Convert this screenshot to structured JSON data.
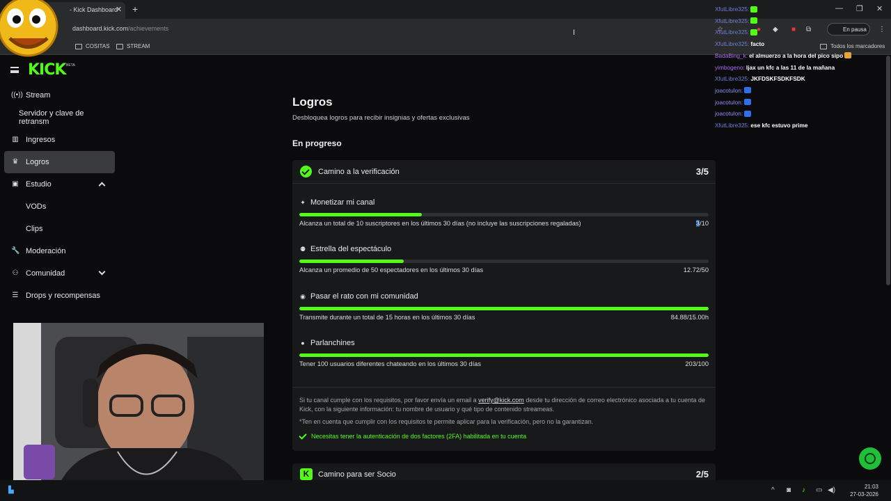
{
  "browser": {
    "tab_title": "- Kick Dashboard",
    "url_host": "dashboard.kick.com",
    "url_path": "/achievements",
    "bookmarks": [
      "COSITAS",
      "STREAM"
    ],
    "bookmarks_all": "Todos los marcadores",
    "pause_label": "En pausa"
  },
  "sidebar": {
    "logo": "KICK",
    "logo_badge": "BETA",
    "items": [
      {
        "label": "Stream"
      },
      {
        "label": "Servidor y clave de retransm"
      },
      {
        "label": "Ingresos"
      },
      {
        "label": "Logros"
      },
      {
        "label": "Estudio"
      },
      {
        "label": "VODs"
      },
      {
        "label": "Clips"
      },
      {
        "label": "Moderación"
      },
      {
        "label": "Comunidad"
      },
      {
        "label": "Drops y recompensas"
      }
    ]
  },
  "main": {
    "title": "Logros",
    "subtitle": "Desbloquea logros para recibir insignias y ofertas exclusivas",
    "section": "En progreso",
    "card1": {
      "title": "Camino a la verificación",
      "count": "3/5",
      "achievements": [
        {
          "icon": "sparkle-icon",
          "title": "Monetizar mi canal",
          "desc": "Alcanza un total de 10 suscriptores en los últimos 30 días (no incluye las suscripciones regaladas)",
          "value_a": "3",
          "value_b": "/10",
          "progress": 0.3
        },
        {
          "icon": "users-icon",
          "title": "Estrella del espectáculo",
          "desc": "Alcanza un promedio de 50 espectadores en los últimos 30 días",
          "value": "12.72/50",
          "progress": 0.2544
        },
        {
          "icon": "broadcast-icon",
          "title": "Pasar el rato con mi comunidad",
          "desc": "Transmite durante un total de 15 horas en los últimos 30 días",
          "value": "84.88/15.00h",
          "progress": 1
        },
        {
          "icon": "chat-icon",
          "title": "Parlanchines",
          "desc": "Tener 100 usuarios diferentes chateando en los últimos 30 días",
          "value": "203/100",
          "progress": 1
        }
      ],
      "footer_pre": "Si tu canal cumple con los requisitos, por favor envía un email a",
      "footer_link": "verify@kick.com",
      "footer_post": "desde tu dirección de correo electrónico asociada a tu cuenta de Kick, con la siguiente información: tu nombre de usuario y qué tipo de contenido streameas.",
      "footer_note": "*Ten en cuenta que cumplir con los requisitos te permite aplicar para la verificación, pero no la garantizan.",
      "footer_2fa": "Necesitas tener la autenticación de dos factores (2FA) habilitada en tu cuenta"
    },
    "card2": {
      "title": "Camino para ser Socio",
      "count": "2/5",
      "badge": "K"
    }
  },
  "chat": [
    {
      "user": "XfutLibre325:",
      "msg": "",
      "emote": "#53fc18",
      "style": ""
    },
    {
      "user": "XfutLibre325:",
      "msg": "",
      "emote": "#53fc18",
      "style": ""
    },
    {
      "user": "XfutLibre325:",
      "msg": "",
      "emote": "#53fc18",
      "style": ""
    },
    {
      "user": "XfutLibre325:",
      "msg": "facto",
      "emote": "",
      "style": ""
    },
    {
      "user": "BadaBing_k:",
      "msg": "el almuerzo a la hora del pico sipo",
      "emote": "#e8a33a",
      "style": "purple"
    },
    {
      "user": "yimbogeno:",
      "msg": "ljax un kfc a las 11 de la mañana",
      "emote": "",
      "style": "purple"
    },
    {
      "user": "XfutLibre325:",
      "msg": "JKFDSKFSDKFSDK",
      "emote": "",
      "style": ""
    },
    {
      "user": "joacotulon:",
      "msg": "",
      "emote": "#2f6fe8",
      "style": "cyan"
    },
    {
      "user": "joacotulon:",
      "msg": "",
      "emote": "#2f6fe8",
      "style": "cyan"
    },
    {
      "user": "joacotulon:",
      "msg": "",
      "emote": "#2f6fe8",
      "style": "cyan"
    },
    {
      "user": "XfutLibre325:",
      "msg": "ese kfc estuvo prime",
      "emote": "",
      "style": ""
    }
  ],
  "taskbar": {
    "time": "21:03",
    "date": "27-03-2026"
  }
}
